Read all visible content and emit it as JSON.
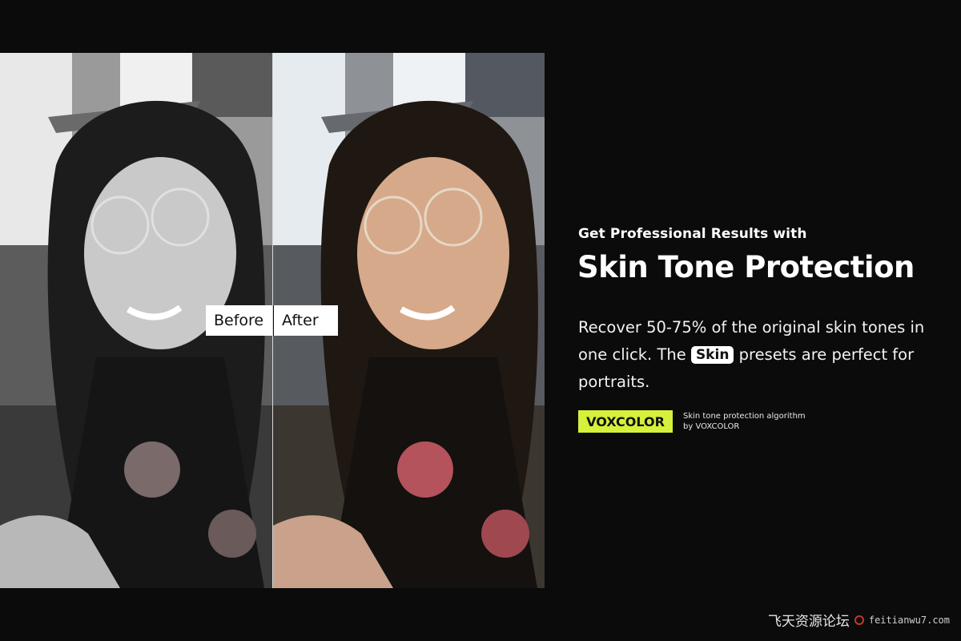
{
  "compare": {
    "before_label": "Before",
    "after_label": "After"
  },
  "promo": {
    "eyebrow": "Get Professional Results with",
    "headline": "Skin Tone Protection",
    "desc_part1": "Recover 50-75% of the original skin tones in one click.  The",
    "desc_chip": "Skin",
    "desc_part2": "presets are perfect for portraits."
  },
  "brand": {
    "badge": "VOXCOLOR",
    "note": "Skin tone protection algorithm by VOXCOLOR",
    "badge_color": "#d6f03b"
  },
  "watermark": {
    "cn_text": "飞天资源论坛",
    "domain": "feitianwu7.com"
  }
}
